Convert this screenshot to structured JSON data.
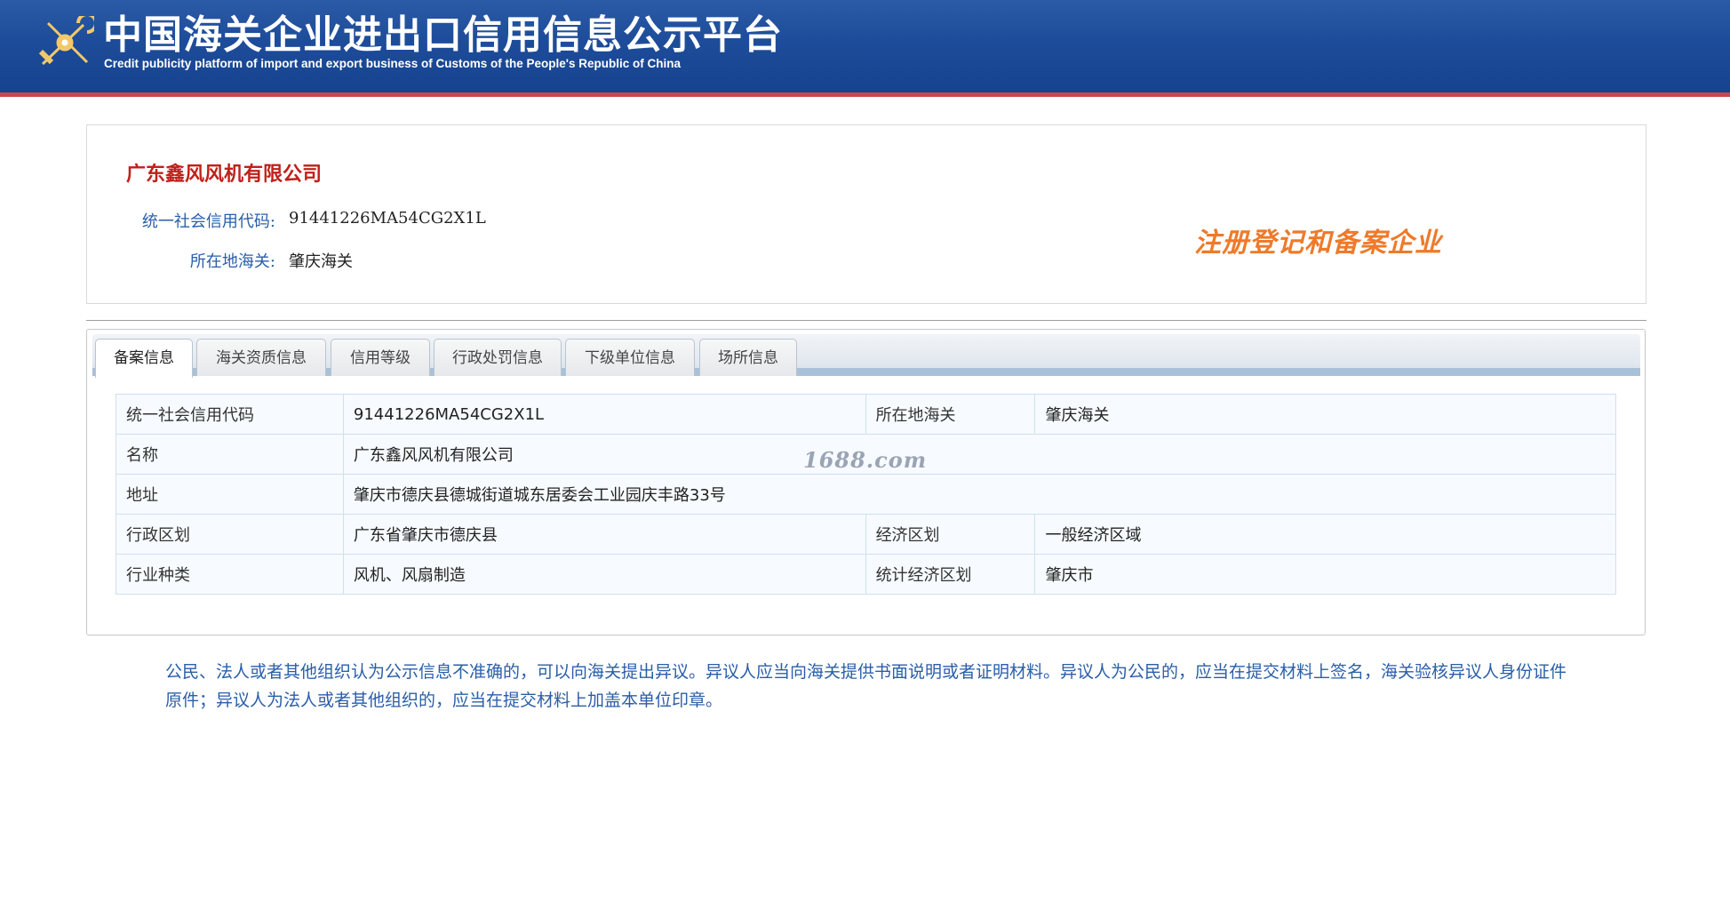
{
  "header": {
    "title": "中国海关企业进出口信用信息公示平台",
    "subtitle": "Credit publicity platform of import and export business of Customs of the People's Republic of China",
    "logo_icon": "customs-emblem-icon",
    "colors": {
      "banner": "#1d4c9a",
      "accent_line": "#c8474b"
    }
  },
  "company": {
    "name": "广东鑫风风机有限公司",
    "credit_code_label": "统一社会信用代码:",
    "credit_code": "91441226MA54CG2X1L",
    "customs_label": "所在地海关:",
    "customs": "肇庆海关",
    "status_stamp": "注册登记和备案企业"
  },
  "tabs": [
    {
      "label": "备案信息",
      "active": true
    },
    {
      "label": "海关资质信息"
    },
    {
      "label": "信用等级"
    },
    {
      "label": "行政处罚信息"
    },
    {
      "label": "下级单位信息"
    },
    {
      "label": "场所信息"
    }
  ],
  "table": {
    "rows": [
      [
        "统一社会信用代码",
        "91441226MA54CG2X1L",
        "所在地海关",
        "肇庆海关"
      ],
      [
        "名称",
        "广东鑫风风机有限公司"
      ],
      [
        "地址",
        "肇庆市德庆县德城街道城东居委会工业园庆丰路33号"
      ],
      [
        "行政区划",
        "广东省肇庆市德庆县",
        "经济区划",
        "一般经济区域"
      ],
      [
        "行业种类",
        "风机、风扇制造",
        "统计经济区划",
        "肇庆市"
      ]
    ]
  },
  "watermark": "1688.com",
  "notice": "公民、法人或者其他组织认为公示信息不准确的，可以向海关提出异议。异议人应当向海关提供书面说明或者证明材料。异议人为公民的，应当在提交材料上签名，海关验核异议人身份证件原件；异议人为法人或者其他组织的，应当在提交材料上加盖本单位印章。"
}
